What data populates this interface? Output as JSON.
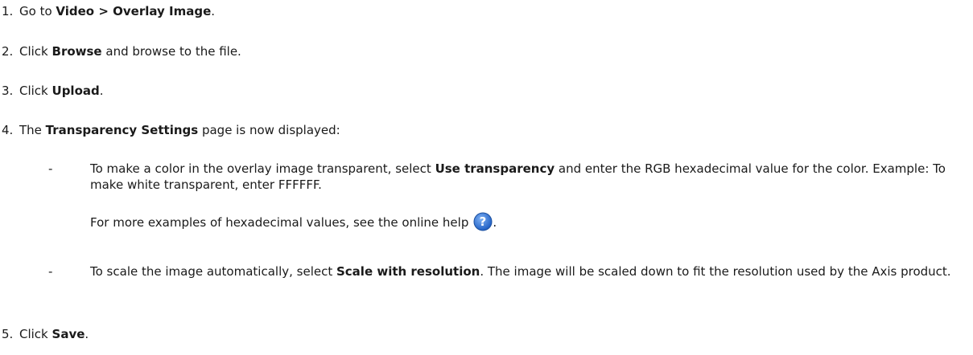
{
  "steps": [
    {
      "num": "1.",
      "pre": "Go to ",
      "bold": "Video > Overlay Image",
      "post": "."
    },
    {
      "num": "2.",
      "pre": "Click ",
      "bold": "Browse",
      "post": " and browse to the file."
    },
    {
      "num": "3.",
      "pre": "Click ",
      "bold": "Upload",
      "post": "."
    },
    {
      "num": "4.",
      "pre": "The ",
      "bold": "Transparency Settings",
      "post": " page is now displayed:"
    },
    {
      "num": "5.",
      "pre": "Click ",
      "bold": "Save",
      "post": "."
    }
  ],
  "bullets": [
    {
      "dash": "-",
      "pre": "To make a color in the overlay image transparent, select ",
      "bold": "Use transparency",
      "post": " and enter the RGB hexadecimal value for the color. Example: To make white transparent, enter FFFFFF.",
      "extra": "For more examples of hexadecimal values, see the online help",
      "extra_end": "."
    },
    {
      "dash": "-",
      "pre": "To scale the image automatically, select ",
      "bold": "Scale with resolution",
      "post": ". The image will be scaled down to fit the resolution used by the Axis product."
    }
  ],
  "icons": {
    "help": "help-question-icon",
    "help_color": "#2a6fd1"
  }
}
